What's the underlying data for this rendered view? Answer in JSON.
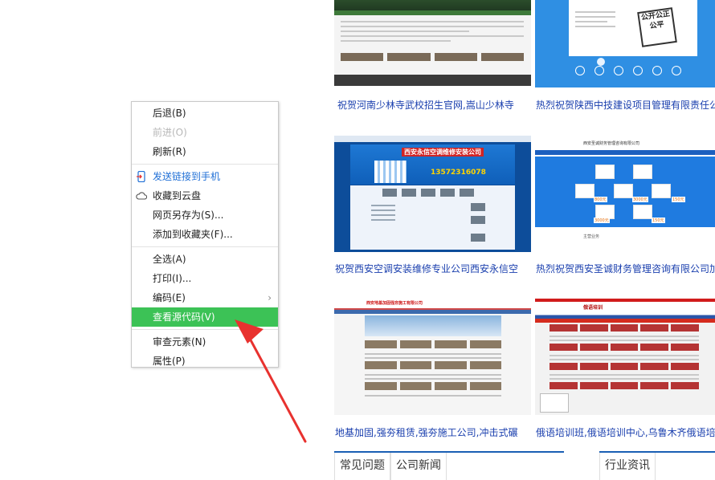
{
  "thumbnails": [
    {
      "caption": "祝贺河南少林寺武校招生官网,嵩山少林寺"
    },
    {
      "caption": "热烈祝贺陕西中技建设项目管理有限责任公",
      "sign_text": "公开公正公平"
    },
    {
      "caption": "祝贺西安空调安装维修专业公司西安永信空",
      "site_name": "西安永信空调维修安装公司",
      "phone": "13572316078"
    },
    {
      "caption": "热烈祝贺西安圣诚财务管理咨询有限公司加",
      "prices": [
        "800元",
        "3000元",
        "3000元",
        "150元",
        "150元"
      ]
    },
    {
      "caption": "地基加固,强夯租赁,强夯施工公司,冲击式碾"
    },
    {
      "caption": "俄语培训班,俄语培训中心,乌鲁木齐俄语培"
    }
  ],
  "bottom_tabs": {
    "left": [
      "常见问题",
      "公司新闻"
    ],
    "right": [
      "行业资讯"
    ]
  },
  "context_menu": {
    "items": [
      {
        "label": "后退(B)",
        "state": "normal"
      },
      {
        "label": "前进(O)",
        "state": "disabled"
      },
      {
        "label": "刷新(R)",
        "state": "normal"
      },
      {
        "label": "发送链接到手机",
        "state": "accent",
        "icon": "phone-send-icon"
      },
      {
        "label": "收藏到云盘",
        "state": "normal",
        "icon": "cloud-icon"
      },
      {
        "label": "网页另存为(S)...",
        "state": "normal"
      },
      {
        "label": "添加到收藏夹(F)...",
        "state": "normal"
      },
      {
        "label": "全选(A)",
        "state": "normal"
      },
      {
        "label": "打印(I)...",
        "state": "normal"
      },
      {
        "label": "编码(E)",
        "state": "normal",
        "submenu": true
      },
      {
        "label": "查看源代码(V)",
        "state": "highlighted"
      },
      {
        "label": "审查元素(N)",
        "state": "normal"
      },
      {
        "label": "属性(P)",
        "state": "normal"
      }
    ]
  },
  "colors": {
    "highlight": "#3cc256",
    "link": "#1a3fae",
    "annotation_arrow": "#e8322f"
  }
}
